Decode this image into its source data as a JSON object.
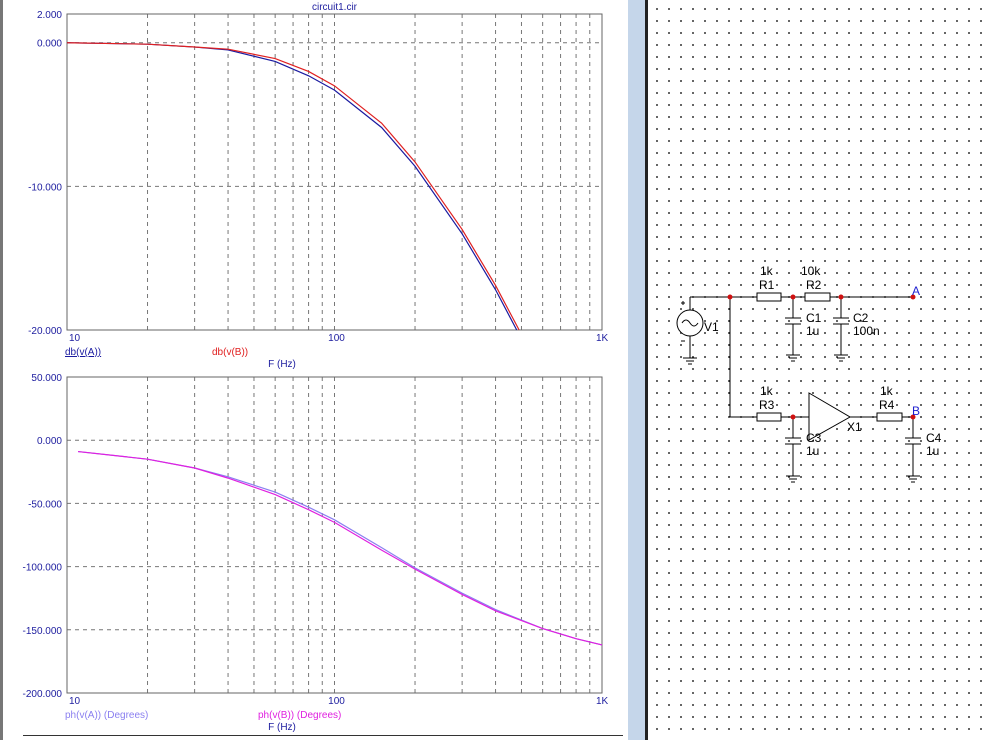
{
  "window": {
    "title": "circuit1.cir"
  },
  "chart_data": [
    {
      "type": "line",
      "title": "circuit1.cir",
      "xscale": "log",
      "xlim": [
        10,
        1000
      ],
      "ylim": [
        -20,
        2
      ],
      "xticks": [
        "10",
        "100",
        "1K"
      ],
      "yticks": [
        "2.000",
        "0.000",
        "-10.000",
        "-20.000"
      ],
      "xlabel": "F (Hz)",
      "series": [
        {
          "name": "db(v(A))",
          "color": "#1a1aa0",
          "x": [
            10,
            20,
            30,
            40,
            60,
            80,
            100,
            150,
            200,
            300,
            400,
            480
          ],
          "y": [
            0,
            -0.1,
            -0.3,
            -0.5,
            -1.3,
            -2.3,
            -3.3,
            -5.9,
            -8.6,
            -13.3,
            -17.2,
            -20
          ]
        },
        {
          "name": "db(v(B))",
          "color": "#e02020",
          "x": [
            10,
            20,
            30,
            40,
            60,
            80,
            100,
            150,
            200,
            300,
            400,
            490
          ],
          "y": [
            0,
            -0.1,
            -0.3,
            -0.45,
            -1.1,
            -2.0,
            -3.0,
            -5.6,
            -8.3,
            -13.0,
            -16.9,
            -20
          ]
        }
      ]
    },
    {
      "type": "line",
      "xscale": "log",
      "xlim": [
        10,
        1000
      ],
      "ylim": [
        -200,
        50
      ],
      "xticks": [
        "10",
        "100",
        "1K"
      ],
      "yticks": [
        "50.000",
        "0.000",
        "-50.000",
        "-100.000",
        "-150.000",
        "-200.000"
      ],
      "xlabel": "F (Hz)",
      "series": [
        {
          "name": "ph(v(A)) (Degrees)",
          "color": "#8a7ff0",
          "x": [
            11,
            20,
            30,
            40,
            60,
            80,
            100,
            150,
            200,
            300,
            400,
            600,
            800,
            1000
          ],
          "y": [
            -9,
            -15,
            -22,
            -29,
            -41,
            -53,
            -63,
            -85,
            -101,
            -121,
            -134,
            -149,
            -157,
            -162
          ]
        },
        {
          "name": "ph(v(B)) (Degrees)",
          "color": "#e020e0",
          "x": [
            11,
            20,
            30,
            40,
            60,
            80,
            100,
            150,
            200,
            300,
            400,
            600,
            800,
            1000
          ],
          "y": [
            -9,
            -15,
            -22,
            -30,
            -43,
            -55,
            -65,
            -87,
            -102,
            -122,
            -135,
            -149,
            -157,
            -162
          ]
        }
      ]
    }
  ],
  "schematic": {
    "components": [
      {
        "ref": "V1",
        "value": ""
      },
      {
        "ref": "R1",
        "value": "1k"
      },
      {
        "ref": "R2",
        "value": "10k"
      },
      {
        "ref": "C1",
        "value": "1u"
      },
      {
        "ref": "C2",
        "value": "100n"
      },
      {
        "ref": "R3",
        "value": "1k"
      },
      {
        "ref": "C3",
        "value": "1u"
      },
      {
        "ref": "X1",
        "value": ""
      },
      {
        "ref": "R4",
        "value": "1k"
      },
      {
        "ref": "C4",
        "value": "1u"
      }
    ],
    "nodes": [
      "A",
      "B"
    ],
    "colors": {
      "wire": "#000000",
      "node": "#d01010",
      "label": "#2020d0"
    }
  }
}
